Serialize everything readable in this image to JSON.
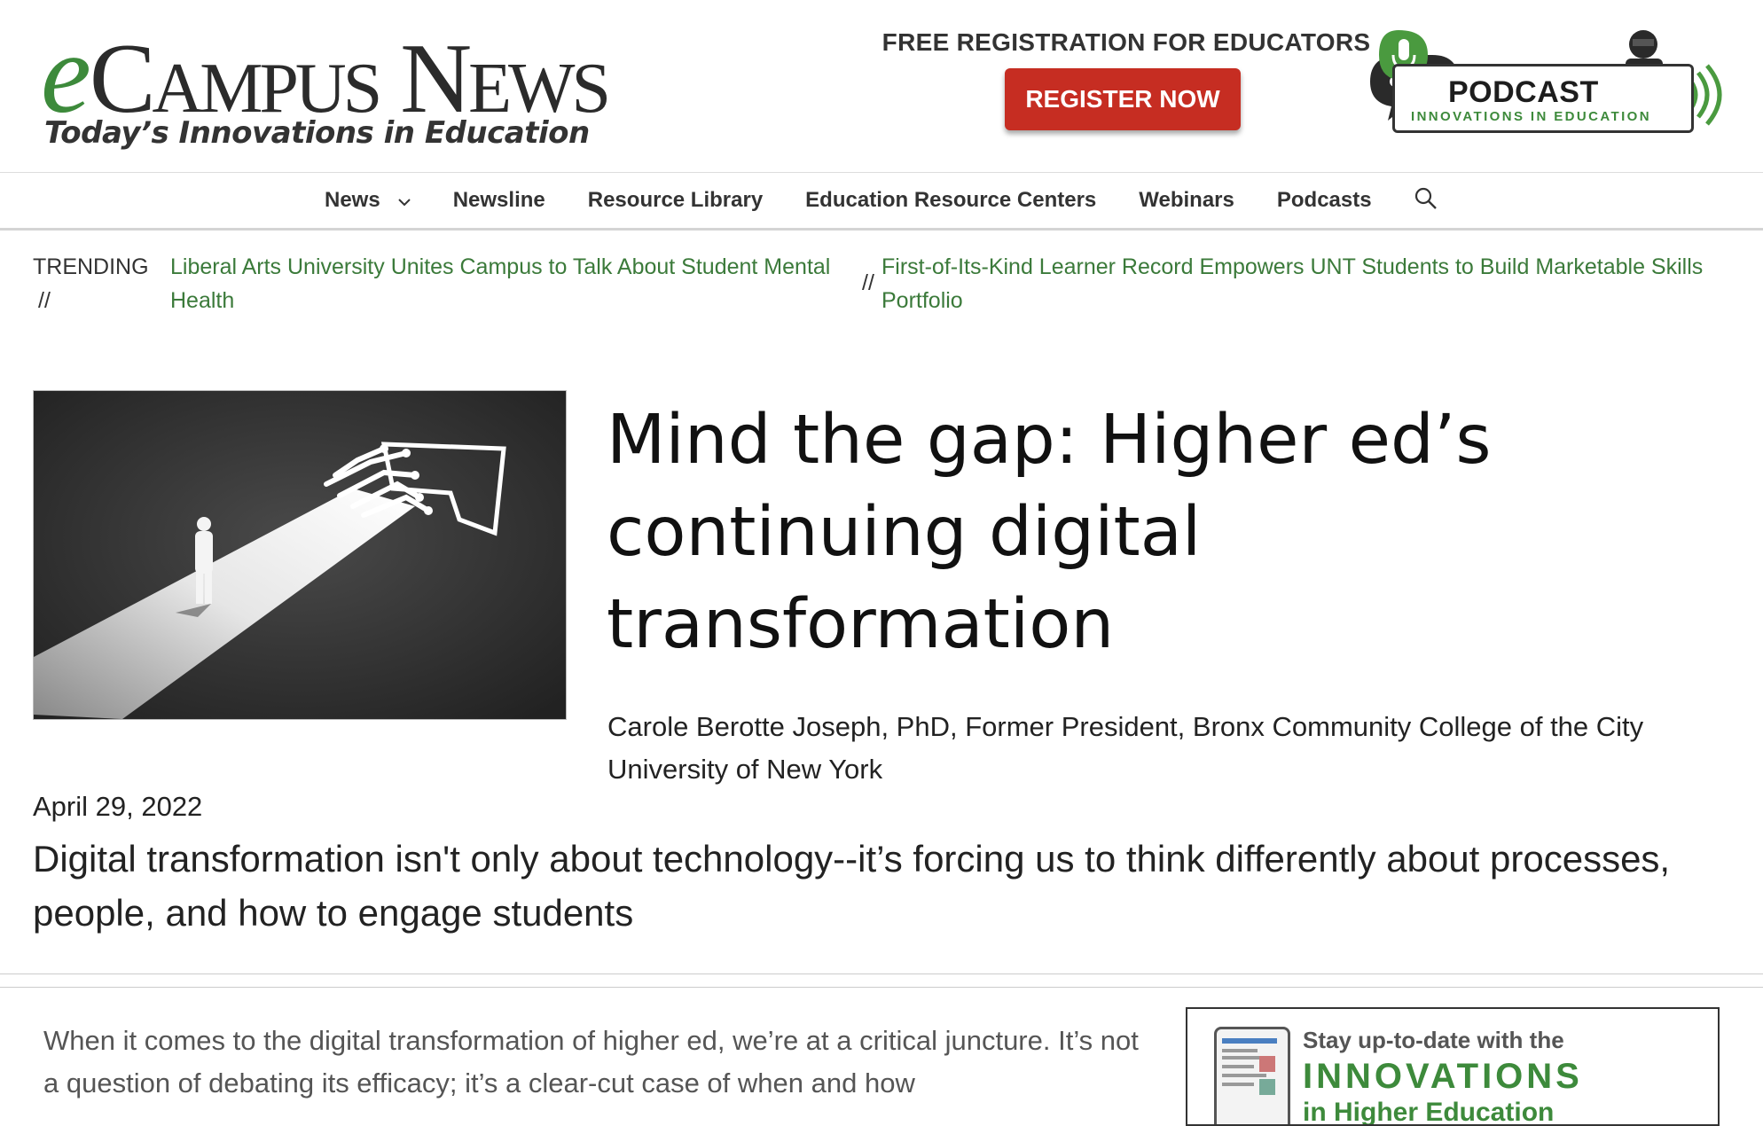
{
  "header": {
    "logo_e": "e",
    "logo_campus_c": "C",
    "logo_campus_rest": "AMPUS",
    "logo_news_n": "N",
    "logo_news_rest": "EWS",
    "tagline": "Today’s Innovations in Education",
    "promo_text": "FREE REGISTRATION FOR EDUCATORS",
    "register_label": "REGISTER NOW",
    "podcast_title": "PODCAST",
    "podcast_subtitle": "INNOVATIONS IN EDUCATION"
  },
  "nav": {
    "items": [
      {
        "label": "News"
      },
      {
        "label": "Newsline"
      },
      {
        "label": "Resource Library"
      },
      {
        "label": "Education Resource Centers"
      },
      {
        "label": "Webinars"
      },
      {
        "label": "Podcasts"
      }
    ]
  },
  "trending": {
    "label": "TRENDING",
    "separator": "//",
    "links": [
      {
        "text": "Liberal Arts University Unites Campus to Talk About Student Mental Health"
      },
      {
        "text": "First-of-Its-Kind Learner Record Empowers UNT Students to Build Marketable Skills Portfolio"
      }
    ]
  },
  "article": {
    "title": "Mind the gap: Higher ed’s continuing digital transformation",
    "byline": "Carole Berotte Joseph, PhD, Former President, Bronx Community College of the City University of New York",
    "date": "April 29, 2022",
    "deck": "Digital transformation isn't only about technology--it’s forcing us to think differently about processes, people, and how to engage students",
    "body": "When it comes to the digital transformation of higher ed, we’re at a critical juncture. It’s not a question of debating its efficacy; it’s a clear-cut case of when and how"
  },
  "newsletter": {
    "line1": "Stay up-to-date with the",
    "line2": "INNOVATIONS",
    "line3": "in Higher Education"
  },
  "colors": {
    "brand_green": "#3d8a3b",
    "register_red": "#c62d22",
    "link_green": "#3b7a3a"
  }
}
